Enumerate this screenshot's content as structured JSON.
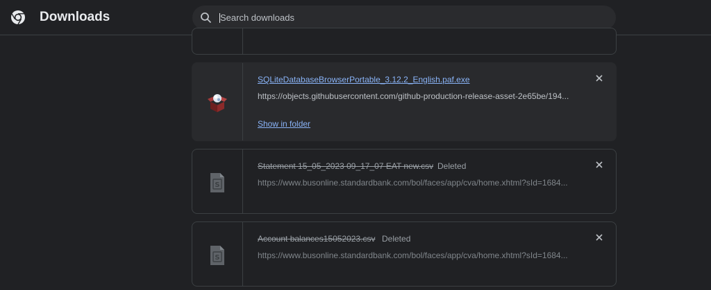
{
  "header": {
    "title": "Downloads",
    "search_placeholder": "Search downloads"
  },
  "downloads": [
    {
      "name": "SQLiteDatabaseBrowserPortable_3.12.2_English.paf.exe",
      "url": "https://objects.githubusercontent.com/github-production-release-asset-2e65be/194...",
      "action": "Show in folder",
      "icon": "package-installer-icon"
    },
    {
      "name": "Statement 15_05_2023 09_17_07 EAT new.csv",
      "status": "Deleted",
      "url": "https://www.busonline.standardbank.com/bol/faces/app/cva/home.xhtml?sId=1684...",
      "icon": "csv-file-icon"
    },
    {
      "name": "Account balances15052023.csv",
      "status": "Deleted",
      "url": "https://www.busonline.standardbank.com/bol/faces/app/cva/home.xhtml?sId=1684...",
      "icon": "csv-file-icon"
    }
  ],
  "colors": {
    "background": "#202124",
    "link": "#8ab4f8",
    "text": "#e8eaed",
    "muted": "#9aa0a6"
  }
}
